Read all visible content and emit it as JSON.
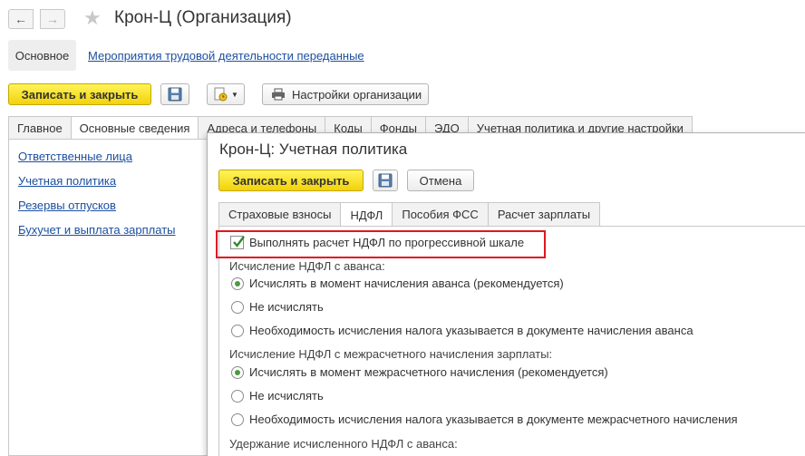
{
  "main_window": {
    "title": "Крон-Ц (Организация)",
    "form_nav": {
      "main_label": "Основное",
      "link_label": "Мероприятия трудовой деятельности переданные"
    },
    "toolbar": {
      "save_close_label": "Записать и закрыть",
      "settings_label": "Настройки организации"
    },
    "tabs": [
      {
        "label": "Главное"
      },
      {
        "label": "Основные сведения"
      },
      {
        "label": "Адреса и телефоны"
      },
      {
        "label": "Коды"
      },
      {
        "label": "Фонды"
      },
      {
        "label": "ЭДО"
      },
      {
        "label": "Учетная политика и другие настройки"
      }
    ],
    "sidebar_links": [
      {
        "label": "Ответственные лица"
      },
      {
        "label": "Учетная политика"
      },
      {
        "label": "Резервы отпусков"
      },
      {
        "label": "Бухучет и выплата зарплаты"
      }
    ]
  },
  "dialog": {
    "title": "Крон-Ц: Учетная политика",
    "save_close_label": "Записать и закрыть",
    "cancel_label": "Отмена",
    "tabs": [
      {
        "label": "Страховые взносы"
      },
      {
        "label": "НДФЛ"
      },
      {
        "label": "Пособия ФСС"
      },
      {
        "label": "Расчет зарплаты"
      }
    ],
    "active_tab": "НДФЛ",
    "progressive_checkbox": {
      "label": "Выполнять расчет НДФЛ по прогрессивной шкале",
      "checked": true
    },
    "advance_section": {
      "label": "Исчисление НДФЛ с аванса:",
      "options": [
        {
          "label": "Исчислять в момент начисления аванса (рекомендуется)",
          "selected": true
        },
        {
          "label": "Не исчислять",
          "selected": false
        },
        {
          "label": "Необходимость исчисления налога указывается в документе начисления аванса",
          "selected": false
        }
      ]
    },
    "interim_section": {
      "label": "Исчисление НДФЛ с межрасчетного начисления зарплаты:",
      "options": [
        {
          "label": "Исчислять в момент межрасчетного начисления (рекомендуется)",
          "selected": true
        },
        {
          "label": "Не исчислять",
          "selected": false
        },
        {
          "label": "Необходимость исчисления налога указывается в документе межрасчетного начисления",
          "selected": false
        }
      ]
    },
    "withholding_section": {
      "label": "Удержание исчисленного НДФЛ с аванса:"
    }
  },
  "colors": {
    "accent_yellow": "#f5d713",
    "link_blue": "#1c4fa0",
    "highlight_red": "#e0161f",
    "radio_green": "#4a9c3e"
  }
}
